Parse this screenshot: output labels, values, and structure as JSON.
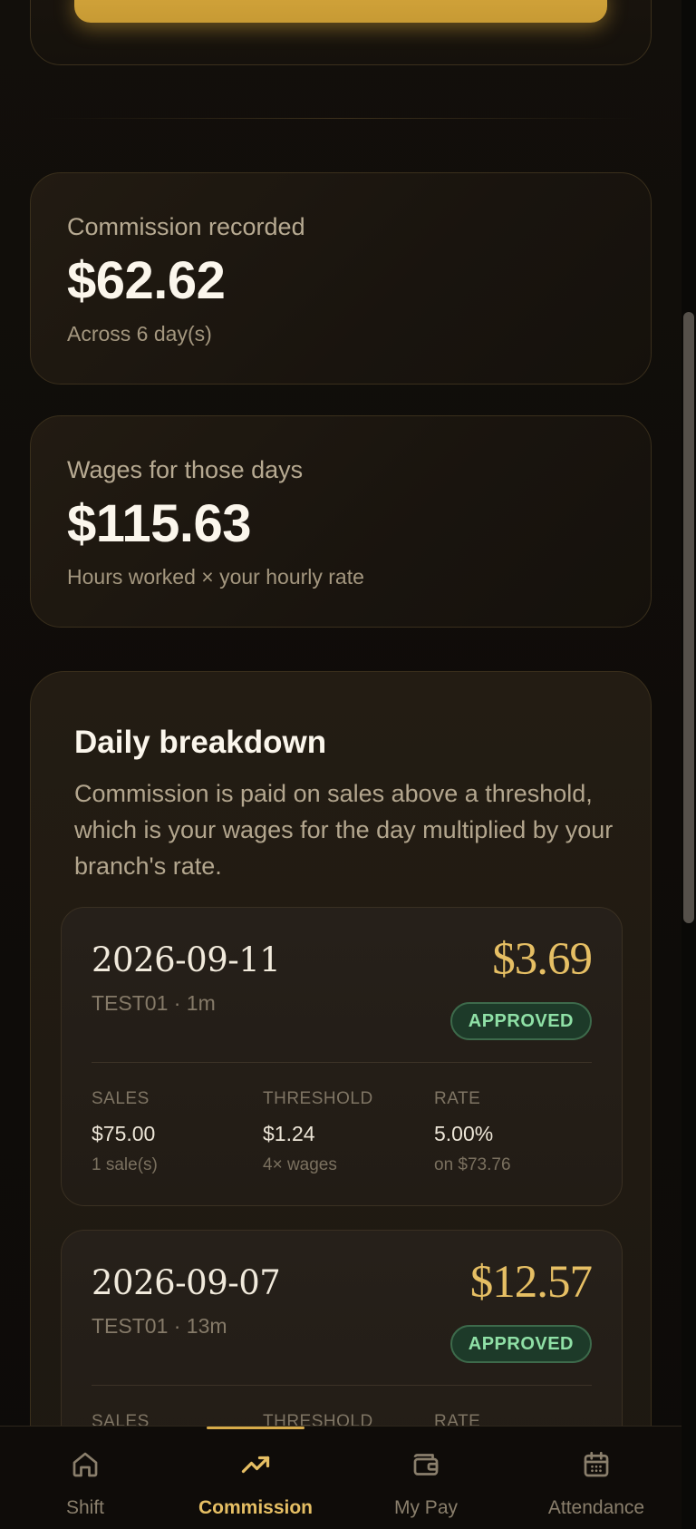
{
  "summary": {
    "commission": {
      "label": "Commission recorded",
      "value": "$62.62",
      "sub": "Across 6 day(s)"
    },
    "wages": {
      "label": "Wages for those days",
      "value": "$115.63",
      "sub": "Hours worked × your hourly rate"
    }
  },
  "breakdown": {
    "title": "Daily breakdown",
    "description": "Commission is paid on sales above a threshold, which is your wages for the day multiplied by your branch's rate.",
    "days": [
      {
        "date": "2026-09-11",
        "meta": "TEST01 · 1m",
        "amount": "$3.69",
        "status": "APPROVED",
        "sales_label": "SALES",
        "sales_value": "$75.00",
        "sales_sub": "1 sale(s)",
        "threshold_label": "THRESHOLD",
        "threshold_value": "$1.24",
        "threshold_sub": "4× wages",
        "rate_label": "RATE",
        "rate_value": "5.00%",
        "rate_sub": "on $73.76"
      },
      {
        "date": "2026-09-07",
        "meta": "TEST01 · 13m",
        "amount": "$12.57",
        "status": "APPROVED",
        "sales_label": "SALES",
        "threshold_label": "THRESHOLD",
        "rate_label": "RATE"
      }
    ]
  },
  "tabs": [
    {
      "label": "Shift",
      "icon": "home-icon",
      "active": false
    },
    {
      "label": "Commission",
      "icon": "trending-up-icon",
      "active": true
    },
    {
      "label": "My Pay",
      "icon": "wallet-icon",
      "active": false
    },
    {
      "label": "Attendance",
      "icon": "calendar-icon",
      "active": false
    }
  ],
  "colors": {
    "accent": "#e6bf64",
    "approved": "#8fe0a6",
    "background": "#0c0a08"
  }
}
